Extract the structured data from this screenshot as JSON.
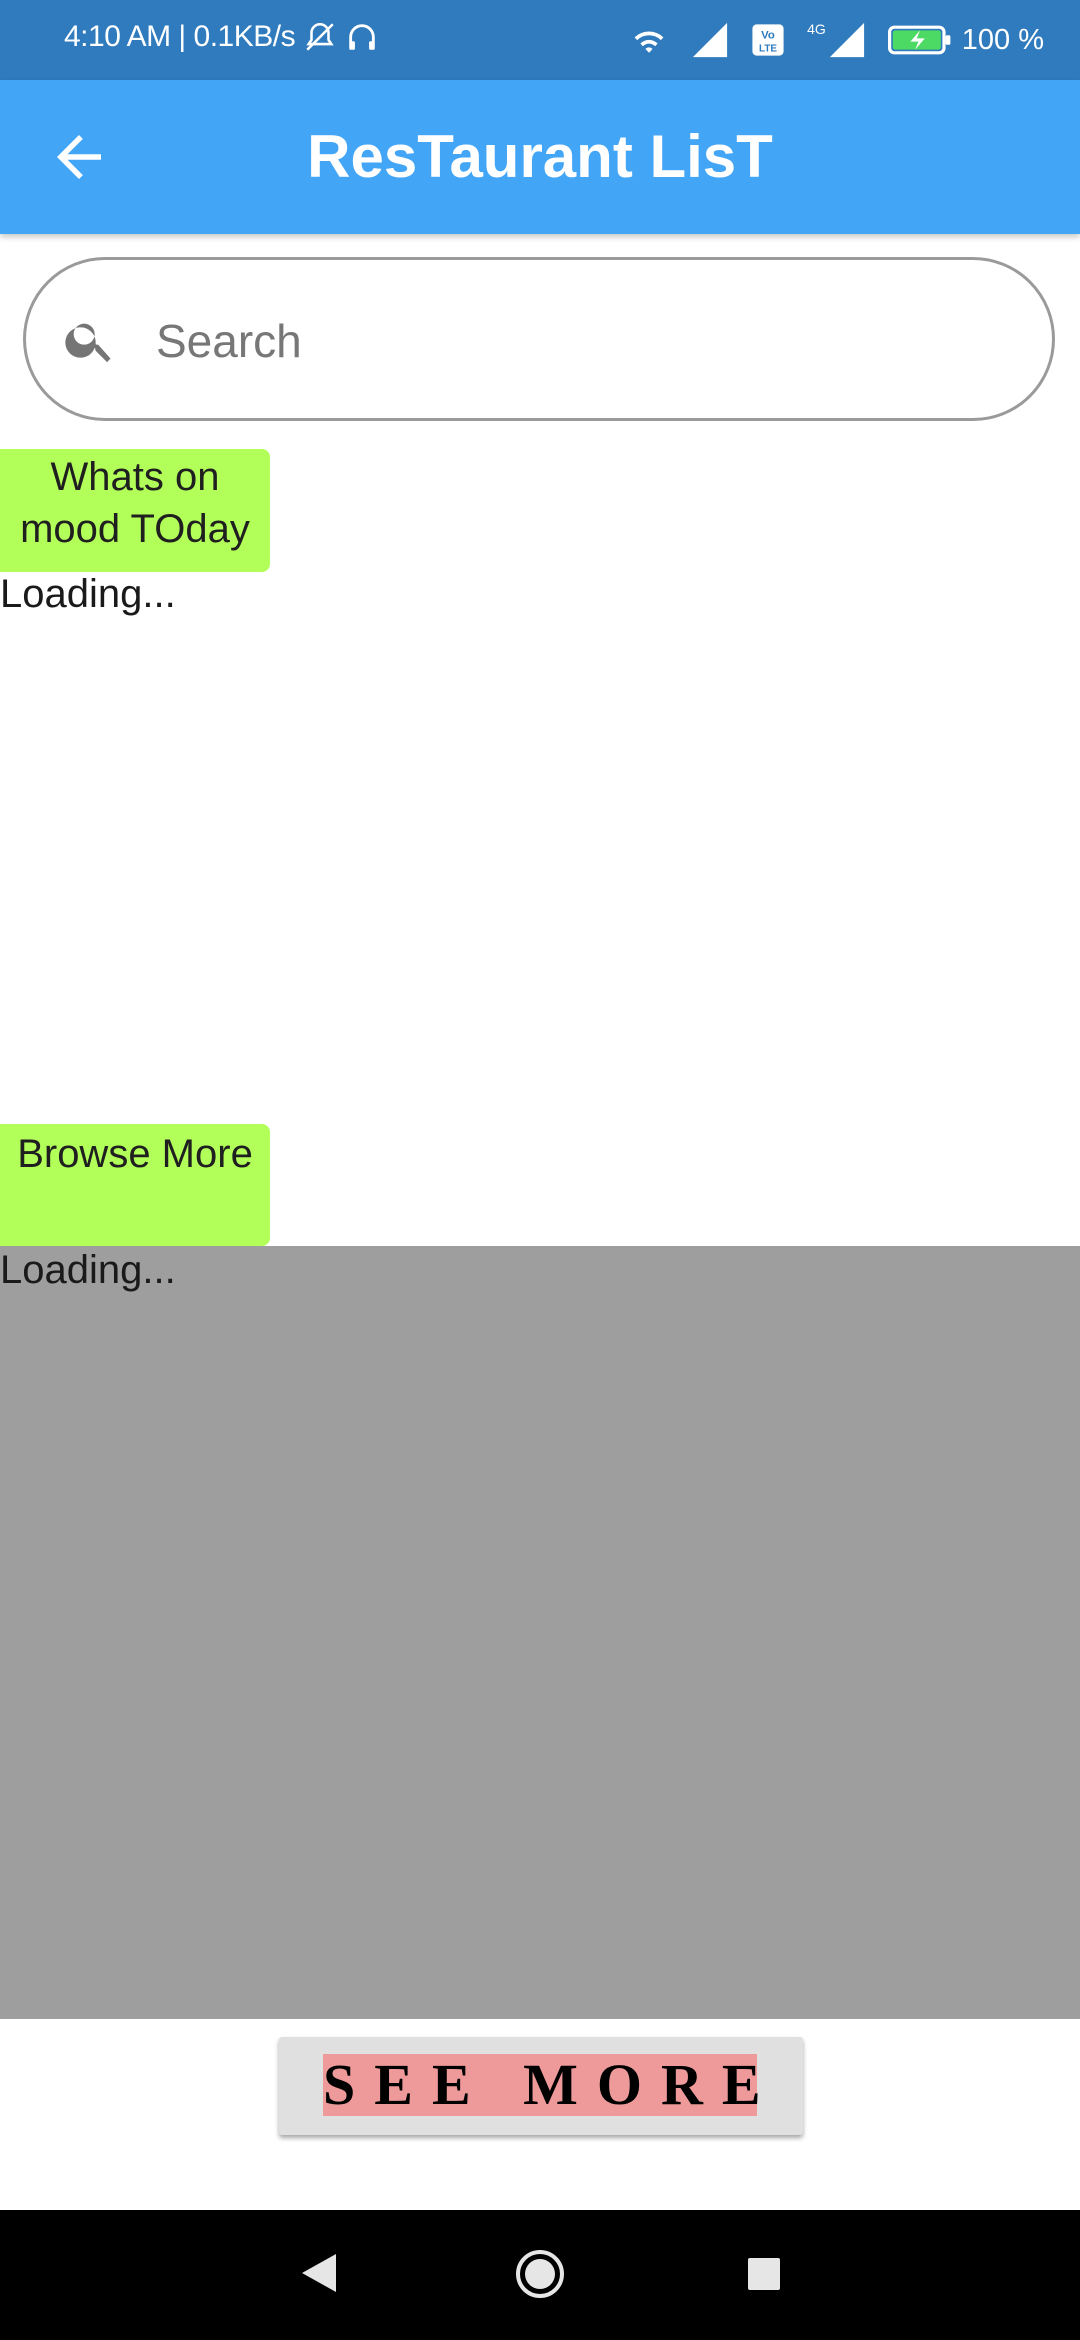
{
  "status_bar": {
    "time_speed": "4:10 AM | 0.1KB/s",
    "icons": [
      "mute-icon",
      "headset-icon",
      "wifi-icon",
      "signal-icon",
      "volte-icon",
      "network-4g-icon",
      "signal-icon",
      "battery-charging-icon"
    ],
    "volte_label": "Vo LTE",
    "network_label": "4G",
    "battery_percent": "100 %",
    "battery_level": 1.0
  },
  "app_bar": {
    "title": "ResTaurant LisT",
    "back_icon": "arrow-left-icon"
  },
  "search": {
    "placeholder": "Search",
    "value": "",
    "icon": "search-icon"
  },
  "sections": [
    {
      "button_label": "Whats on mood TOday",
      "status": "Loading..."
    },
    {
      "button_label": "Browse More",
      "status": "Loading..."
    }
  ],
  "see_more": {
    "label": "SEE MORE"
  },
  "nav_bar": {
    "icons": [
      "nav-back-icon",
      "nav-home-icon",
      "nav-recent-icon"
    ]
  },
  "colors": {
    "status_bar": "#2f7bbd",
    "app_bar": "#42a5f5",
    "section_button": "#b2ff59",
    "gray_panel": "#9e9e9e",
    "see_more_bg": "#e0e0e0",
    "see_more_highlight": "#ef9a9a"
  }
}
